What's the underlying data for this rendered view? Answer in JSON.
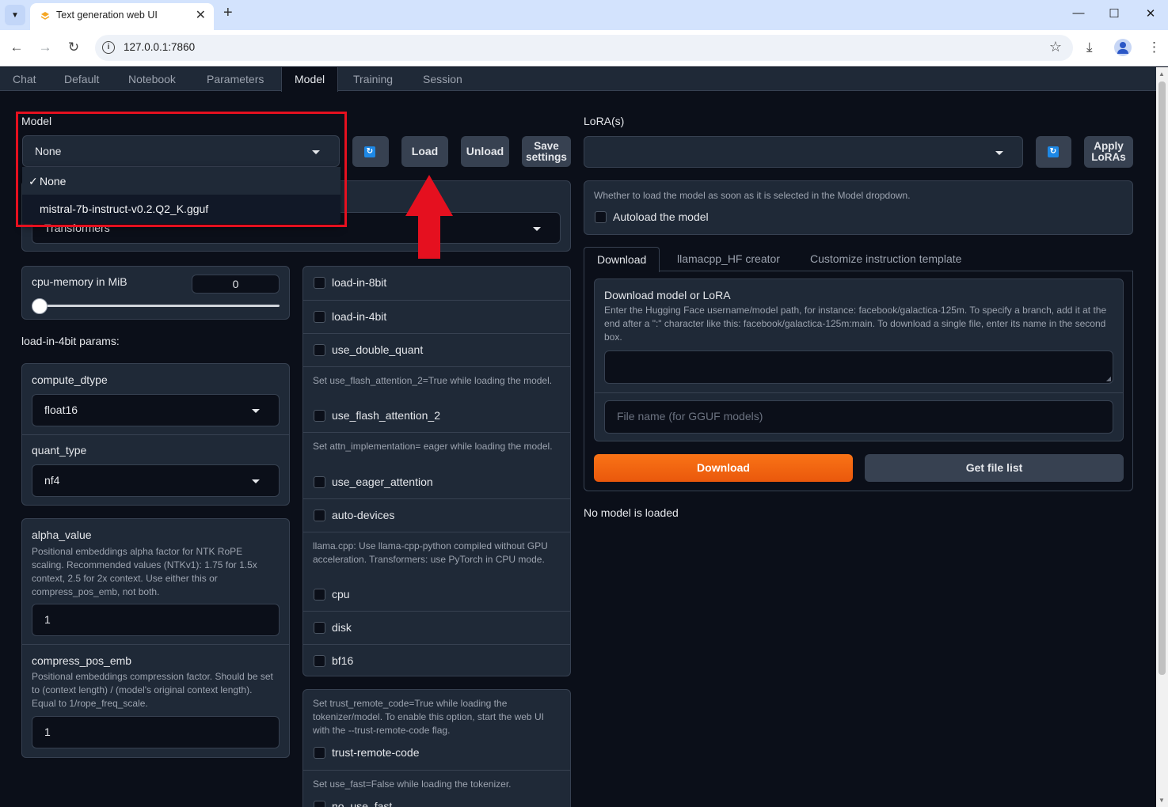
{
  "browser": {
    "tab_title": "Text generation web UI",
    "url": "127.0.0.1:7860"
  },
  "app_tabs": [
    "Chat",
    "Default",
    "Notebook",
    "Parameters",
    "Model",
    "Training",
    "Session"
  ],
  "active_tab": "Model",
  "model": {
    "label": "Model",
    "selected": "None",
    "dropdown_open": true,
    "options": [
      {
        "check": "✓",
        "label": "None"
      },
      {
        "check": "",
        "label": "mistral-7b-instruct-v0.2.Q2_K.gguf"
      }
    ],
    "load_button": "Load",
    "unload_button": "Unload",
    "save_button_line1": "Save",
    "save_button_line2": "settings"
  },
  "loader": {
    "value_partial": "Transformers"
  },
  "cpu_memory": {
    "label": "cpu-memory in MiB",
    "value": "0",
    "slider_fraction": 0
  },
  "load4bit_params_label": "load-in-4bit params:",
  "compute_dtype": {
    "label": "compute_dtype",
    "value": "float16"
  },
  "quant_type": {
    "label": "quant_type",
    "value": "nf4"
  },
  "alpha_value": {
    "label": "alpha_value",
    "info": "Positional embeddings alpha factor for NTK RoPE scaling. Recommended values (NTKv1): 1.75 for 1.5x context, 2.5 for 2x context. Use either this or compress_pos_emb, not both.",
    "value": "1"
  },
  "compress_pos_emb": {
    "label": "compress_pos_emb",
    "info": "Positional embeddings compression factor. Should be set to (context length) / (model's original context length). Equal to 1/rope_freq_scale.",
    "value": "1"
  },
  "checkboxes": {
    "load_in_8bit": "load-in-8bit",
    "load_in_4bit": "load-in-4bit",
    "use_double_quant": "use_double_quant",
    "flash_info": "Set use_flash_attention_2=True while loading the model.",
    "use_flash_attention_2": "use_flash_attention_2",
    "eager_info": "Set attn_implementation= eager while loading the model.",
    "use_eager_attention": "use_eager_attention",
    "auto_devices": "auto-devices",
    "cpu_info": "llama.cpp: Use llama-cpp-python compiled without GPU acceleration. Transformers: use PyTorch in CPU mode.",
    "cpu": "cpu",
    "disk": "disk",
    "bf16": "bf16",
    "trust_info": "Set trust_remote_code=True while loading the tokenizer/model. To enable this option, start the web UI with the --trust-remote-code flag.",
    "trust_remote_code": "trust-remote-code",
    "fast_info": "Set use_fast=False while loading the tokenizer.",
    "no_use_fast": "no_use_fast"
  },
  "lora": {
    "label": "LoRA(s)",
    "apply_line1": "Apply",
    "apply_line2": "LoRAs"
  },
  "autoload": {
    "info": "Whether to load the model as soon as it is selected in the Model dropdown.",
    "label": "Autoload the model"
  },
  "right_tabs": [
    "Download",
    "llamacpp_HF creator",
    "Customize instruction template"
  ],
  "download": {
    "title": "Download model or LoRA",
    "info": "Enter the Hugging Face username/model path, for instance: facebook/galactica-125m. To specify a branch, add it at the end after a \":\" character like this: facebook/galactica-125m:main. To download a single file, enter its name in the second box.",
    "file_placeholder": "File name (for GGUF models)",
    "download_button": "Download",
    "file_list_button": "Get file list"
  },
  "status": "No model is loaded",
  "colors": {
    "background": "#0b0f19",
    "panel": "#1f2937",
    "accent_orange": "#f97316",
    "highlight_red": "#e5101f"
  }
}
